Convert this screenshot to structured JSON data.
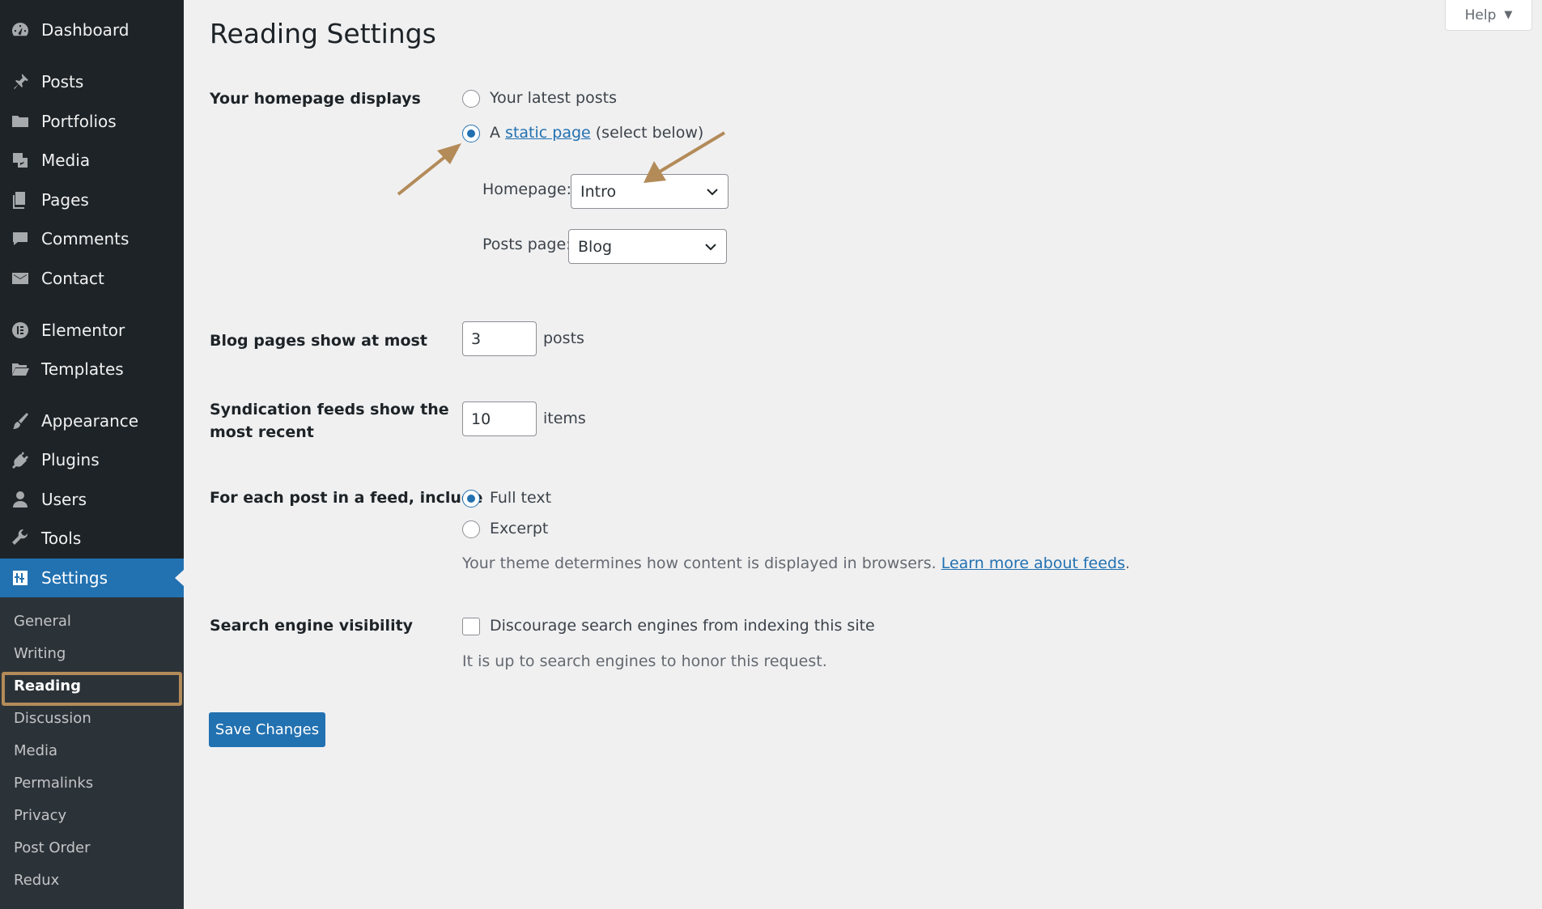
{
  "sidebar": {
    "items": [
      {
        "label": "Dashboard",
        "icon": "dashboard-icon"
      },
      {
        "label": "Posts",
        "icon": "pin-icon"
      },
      {
        "label": "Portfolios",
        "icon": "folder-icon"
      },
      {
        "label": "Media",
        "icon": "media-icon"
      },
      {
        "label": "Pages",
        "icon": "pages-icon"
      },
      {
        "label": "Comments",
        "icon": "comment-icon"
      },
      {
        "label": "Contact",
        "icon": "mail-icon"
      },
      {
        "label": "Elementor",
        "icon": "elementor-icon"
      },
      {
        "label": "Templates",
        "icon": "folder-open-icon"
      },
      {
        "label": "Appearance",
        "icon": "brush-icon"
      },
      {
        "label": "Plugins",
        "icon": "plug-icon"
      },
      {
        "label": "Users",
        "icon": "user-icon"
      },
      {
        "label": "Tools",
        "icon": "wrench-icon"
      },
      {
        "label": "Settings",
        "icon": "settings-icon"
      }
    ],
    "submenu": [
      "General",
      "Writing",
      "Reading",
      "Discussion",
      "Media",
      "Permalinks",
      "Privacy",
      "Post Order",
      "Redux"
    ],
    "current_submenu": "Reading"
  },
  "header": {
    "help_label": "Help",
    "title": "Reading Settings"
  },
  "form": {
    "homepage_displays": {
      "label": "Your homepage displays",
      "option_latest": "Your latest posts",
      "option_static_prefix": "A",
      "option_static_link": "static page",
      "option_static_suffix": "(select below)",
      "selected": "static page",
      "homepage_label": "Homepage:",
      "homepage_value": "Intro",
      "posts_page_label": "Posts page:",
      "posts_page_value": "Blog"
    },
    "blog_pages": {
      "label": "Blog pages show at most",
      "value": "3",
      "unit": "posts"
    },
    "syndication": {
      "label_line1": "Syndication feeds show the",
      "label_line2": "most recent",
      "value": "10",
      "unit": "items"
    },
    "feed_include": {
      "label": "For each post in a feed, include",
      "option_full": "Full text",
      "option_excerpt": "Excerpt",
      "selected": "Full text",
      "desc_prefix": "Your theme determines how content is displayed in browsers.",
      "desc_link": "Learn more about feeds",
      "desc_suffix": "."
    },
    "search_visibility": {
      "label": "Search engine visibility",
      "checkbox_label": "Discourage search engines from indexing this site",
      "checked": false,
      "desc": "It is up to search engines to honor this request."
    },
    "save_label": "Save Changes"
  },
  "colors": {
    "sidebar_bg": "#1d2327",
    "submenu_bg": "#2c3338",
    "accent": "#2271b1",
    "annotation": "#b38b59",
    "page_bg": "#f0f0f1"
  }
}
